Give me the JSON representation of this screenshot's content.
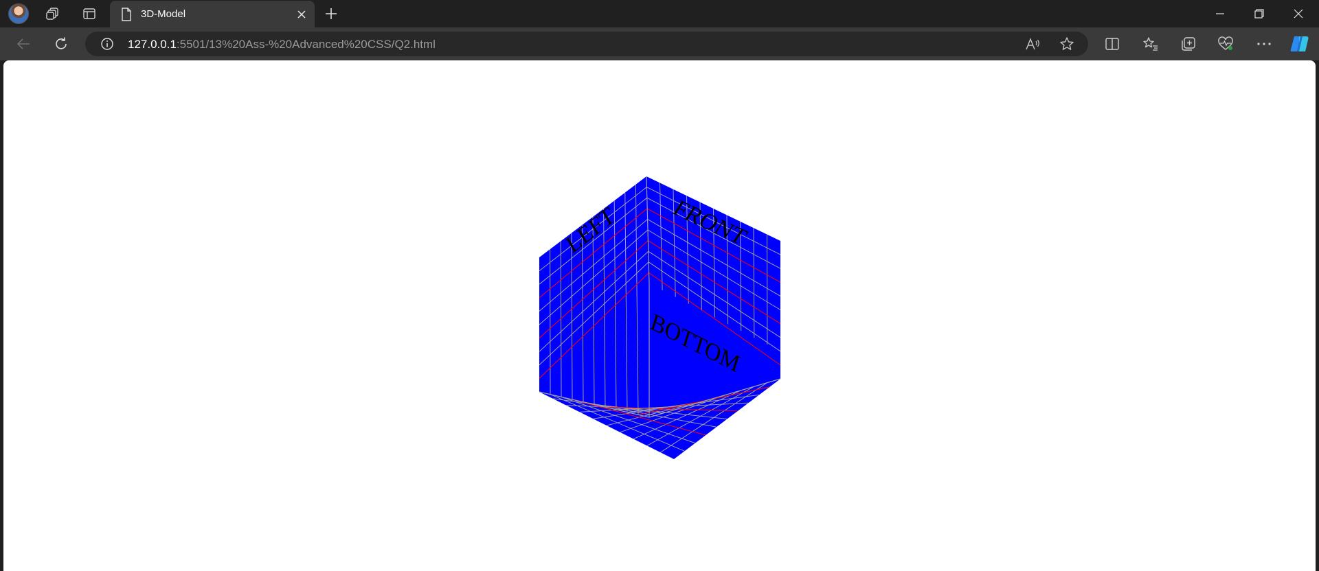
{
  "browser": {
    "tab_title": "3D-Model",
    "url_host": "127.0.0.1",
    "url_rest": ":5501/13%20Ass-%20Advanced%20CSS/Q2.html"
  },
  "scene": {
    "faces": {
      "left_label": "LEFT",
      "front_label": "FRONT",
      "bottom_label": "BOTTOM"
    },
    "face_color": "#0000ff",
    "grid_line_color": "#a0a0a0",
    "accent_line_color": "#ff0000",
    "text_color": "#000000"
  }
}
